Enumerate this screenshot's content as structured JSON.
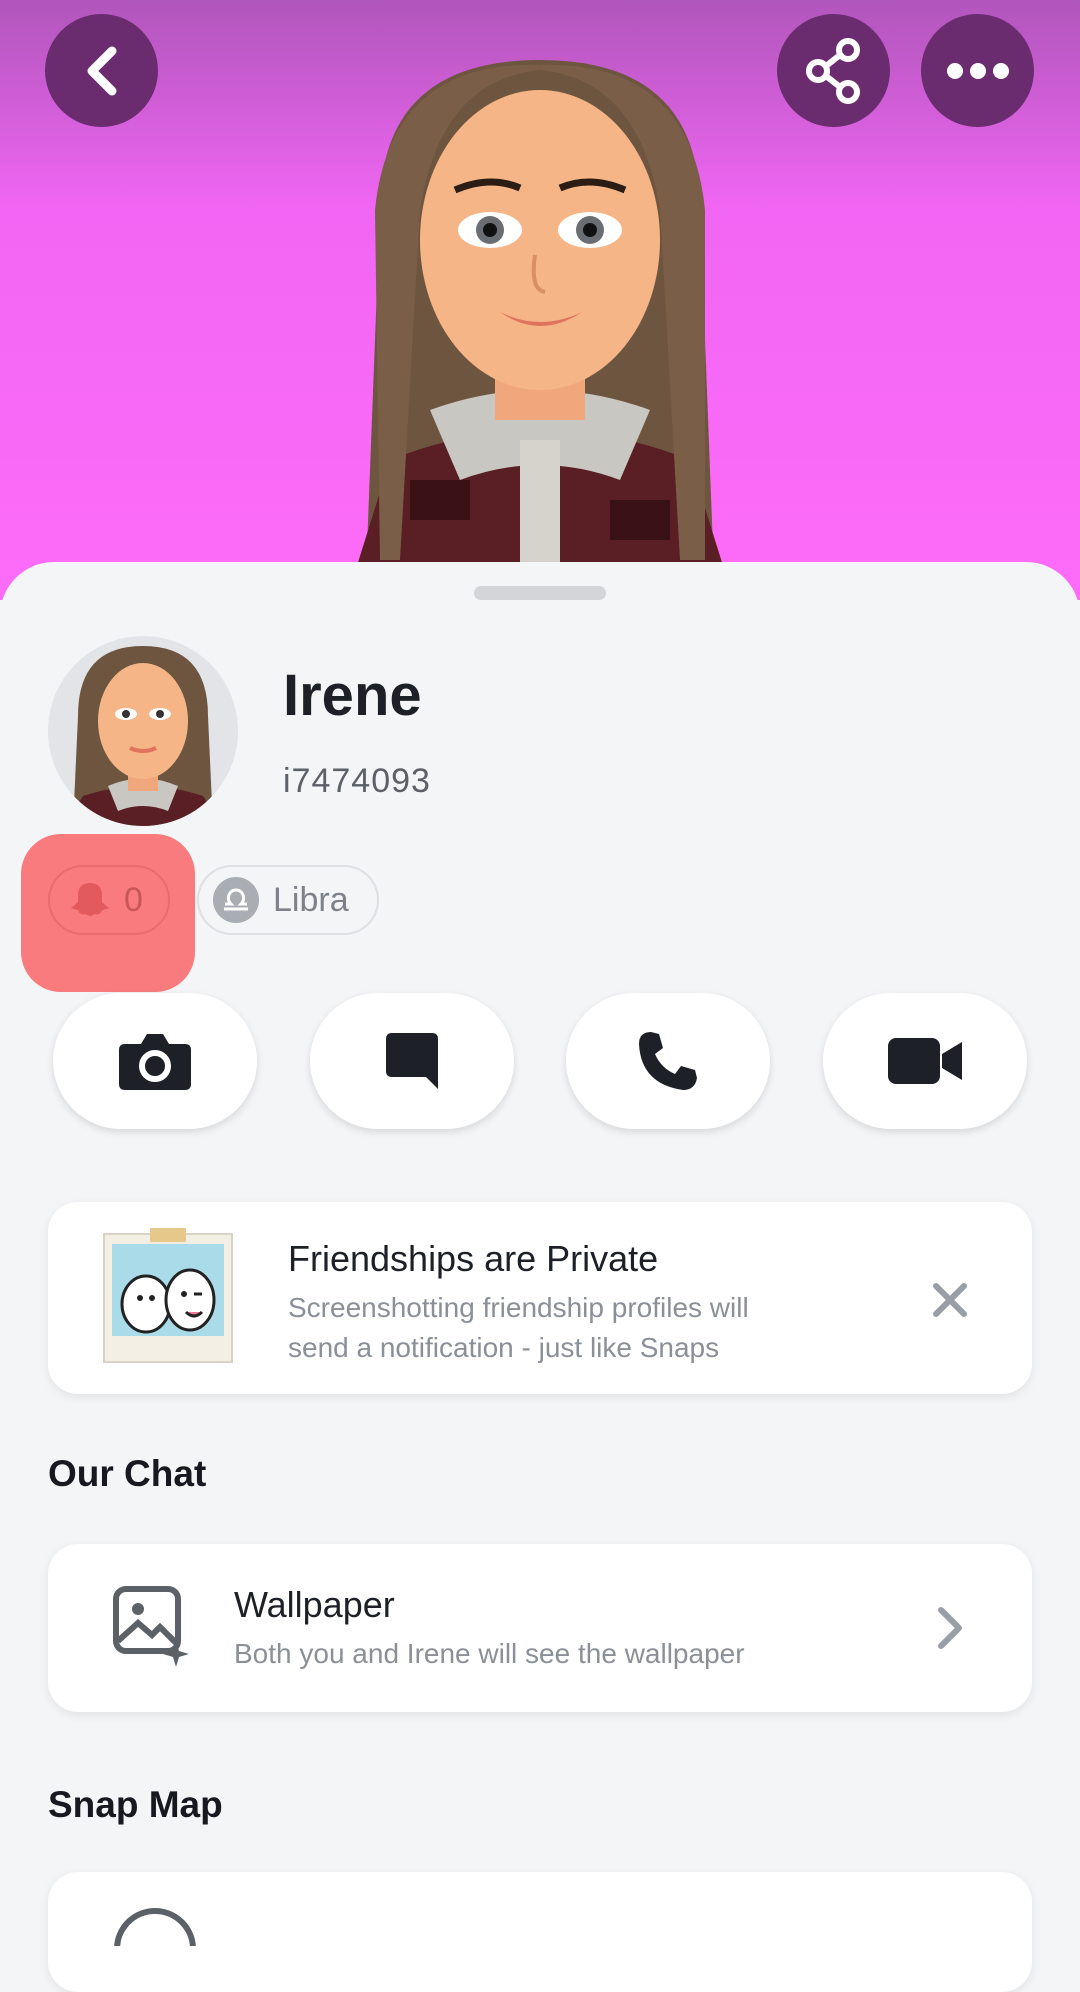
{
  "profile": {
    "name": "Irene",
    "username": "i7474093",
    "snapscore": "0",
    "zodiac": "Libra"
  },
  "header": {
    "back_icon": "chevron-left-icon",
    "share_icon": "share-icon",
    "more_icon": "more-horizontal-icon",
    "banner_color": "#fd6cf8"
  },
  "actions": [
    {
      "icon": "camera-icon"
    },
    {
      "icon": "chat-icon"
    },
    {
      "icon": "phone-icon"
    },
    {
      "icon": "video-icon"
    }
  ],
  "privacy_card": {
    "title": "Friendships are Private",
    "subtitle_line1": "Screenshotting friendship profiles will",
    "subtitle_line2": "send a notification - just like Snaps",
    "close_icon": "close-icon"
  },
  "our_chat": {
    "section_title": "Our Chat",
    "wallpaper_title": "Wallpaper",
    "wallpaper_subtitle": "Both you and Irene will see the wallpaper"
  },
  "snap_map": {
    "section_title": "Snap Map"
  },
  "colors": {
    "highlight": "#f97b7d",
    "text_primary": "#1d2127",
    "text_secondary": "#8b9098"
  }
}
